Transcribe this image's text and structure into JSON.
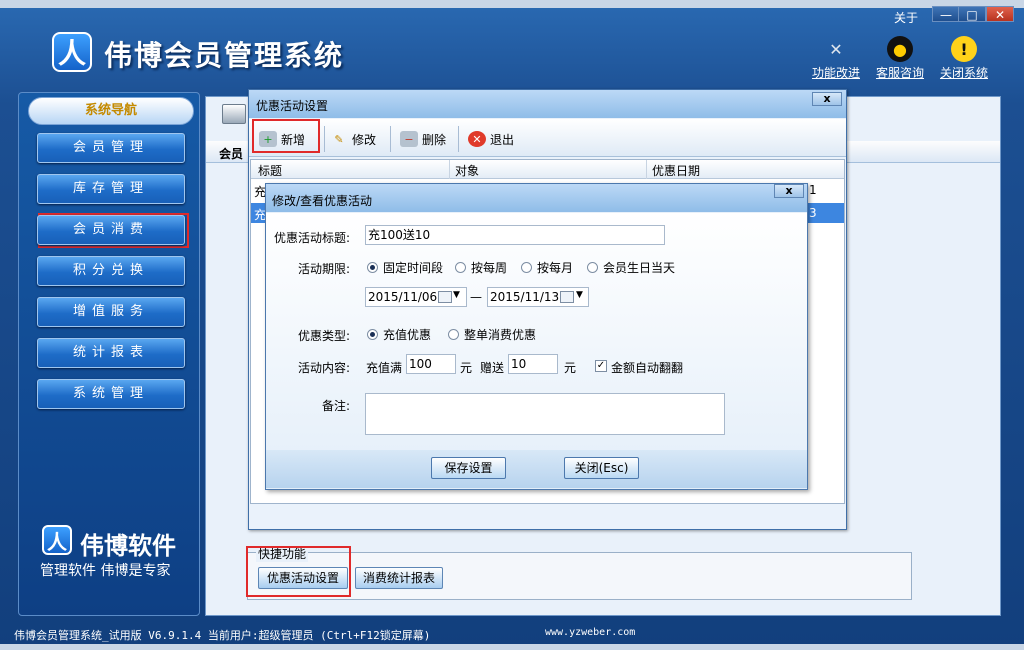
{
  "app": {
    "title": "伟博会员管理系统",
    "about": "关于",
    "window_controls": [
      "—",
      "□",
      "✕"
    ],
    "tools": [
      {
        "label": "功能改进",
        "icon": "tools-icon"
      },
      {
        "label": "客服咨询",
        "icon": "qq-penguin-icon"
      },
      {
        "label": "关闭系统",
        "icon": "warning-icon"
      }
    ]
  },
  "sidebar": {
    "title": "系统导航",
    "items": [
      {
        "label": "会员管理"
      },
      {
        "label": "库存管理"
      },
      {
        "label": "会员消费"
      },
      {
        "label": "积分兑换"
      },
      {
        "label": "增值服务"
      },
      {
        "label": "统计报表"
      },
      {
        "label": "系统管理"
      }
    ],
    "brand_name": "伟博软件",
    "brand_slogan": "管理软件 伟博是专家"
  },
  "content": {
    "header_label": "会员",
    "quick": {
      "title": "快捷功能",
      "buttons": [
        {
          "label": "优惠活动设置"
        },
        {
          "label": "消费统计报表"
        }
      ]
    }
  },
  "status": {
    "text": "伟博会员管理系统_试用版 V6.9.1.4 当前用户:超级管理员 (Ctrl+F12锁定屏幕)",
    "url": "www.yzweber.com"
  },
  "dialog_promo": {
    "title": "优惠活动设置",
    "close": "x",
    "toolbar": [
      {
        "label": "新增",
        "icon": "add-icon"
      },
      {
        "label": "修改",
        "icon": "edit-icon"
      },
      {
        "label": "删除",
        "icon": "delete-icon"
      },
      {
        "label": "退出",
        "icon": "exit-icon"
      }
    ],
    "columns": [
      "标题",
      "对象",
      "优惠日期"
    ],
    "rows": [
      {
        "title": "充",
        "date": "1"
      },
      {
        "title": "充",
        "date": "3"
      }
    ]
  },
  "dialog_edit": {
    "title": "修改/查看优惠活动",
    "close": "x",
    "label_title": "优惠活动标题:",
    "value_title": "充100送10",
    "label_period": "活动期限:",
    "period_options": [
      {
        "label": "固定时间段",
        "selected": true
      },
      {
        "label": "按每周",
        "selected": false
      },
      {
        "label": "按每月",
        "selected": false
      },
      {
        "label": "会员生日当天",
        "selected": false
      }
    ],
    "date_from": "2015/11/06",
    "date_sep": "—",
    "date_to": "2015/11/13",
    "label_type": "优惠类型:",
    "type_options": [
      {
        "label": "充值优惠",
        "selected": true
      },
      {
        "label": "整单消费优惠",
        "selected": false
      }
    ],
    "label_content": "活动内容:",
    "recharge_prefix": "充值满",
    "recharge_amount": "100",
    "unit1": "元",
    "gift_label": "赠送",
    "gift_amount": "10",
    "unit2": "元",
    "auto_double_label": "金额自动翻翻",
    "auto_double_checked": true,
    "label_note": "备注:",
    "note_value": "",
    "save_label": "保存设置",
    "close_label": "关闭(Esc)"
  }
}
